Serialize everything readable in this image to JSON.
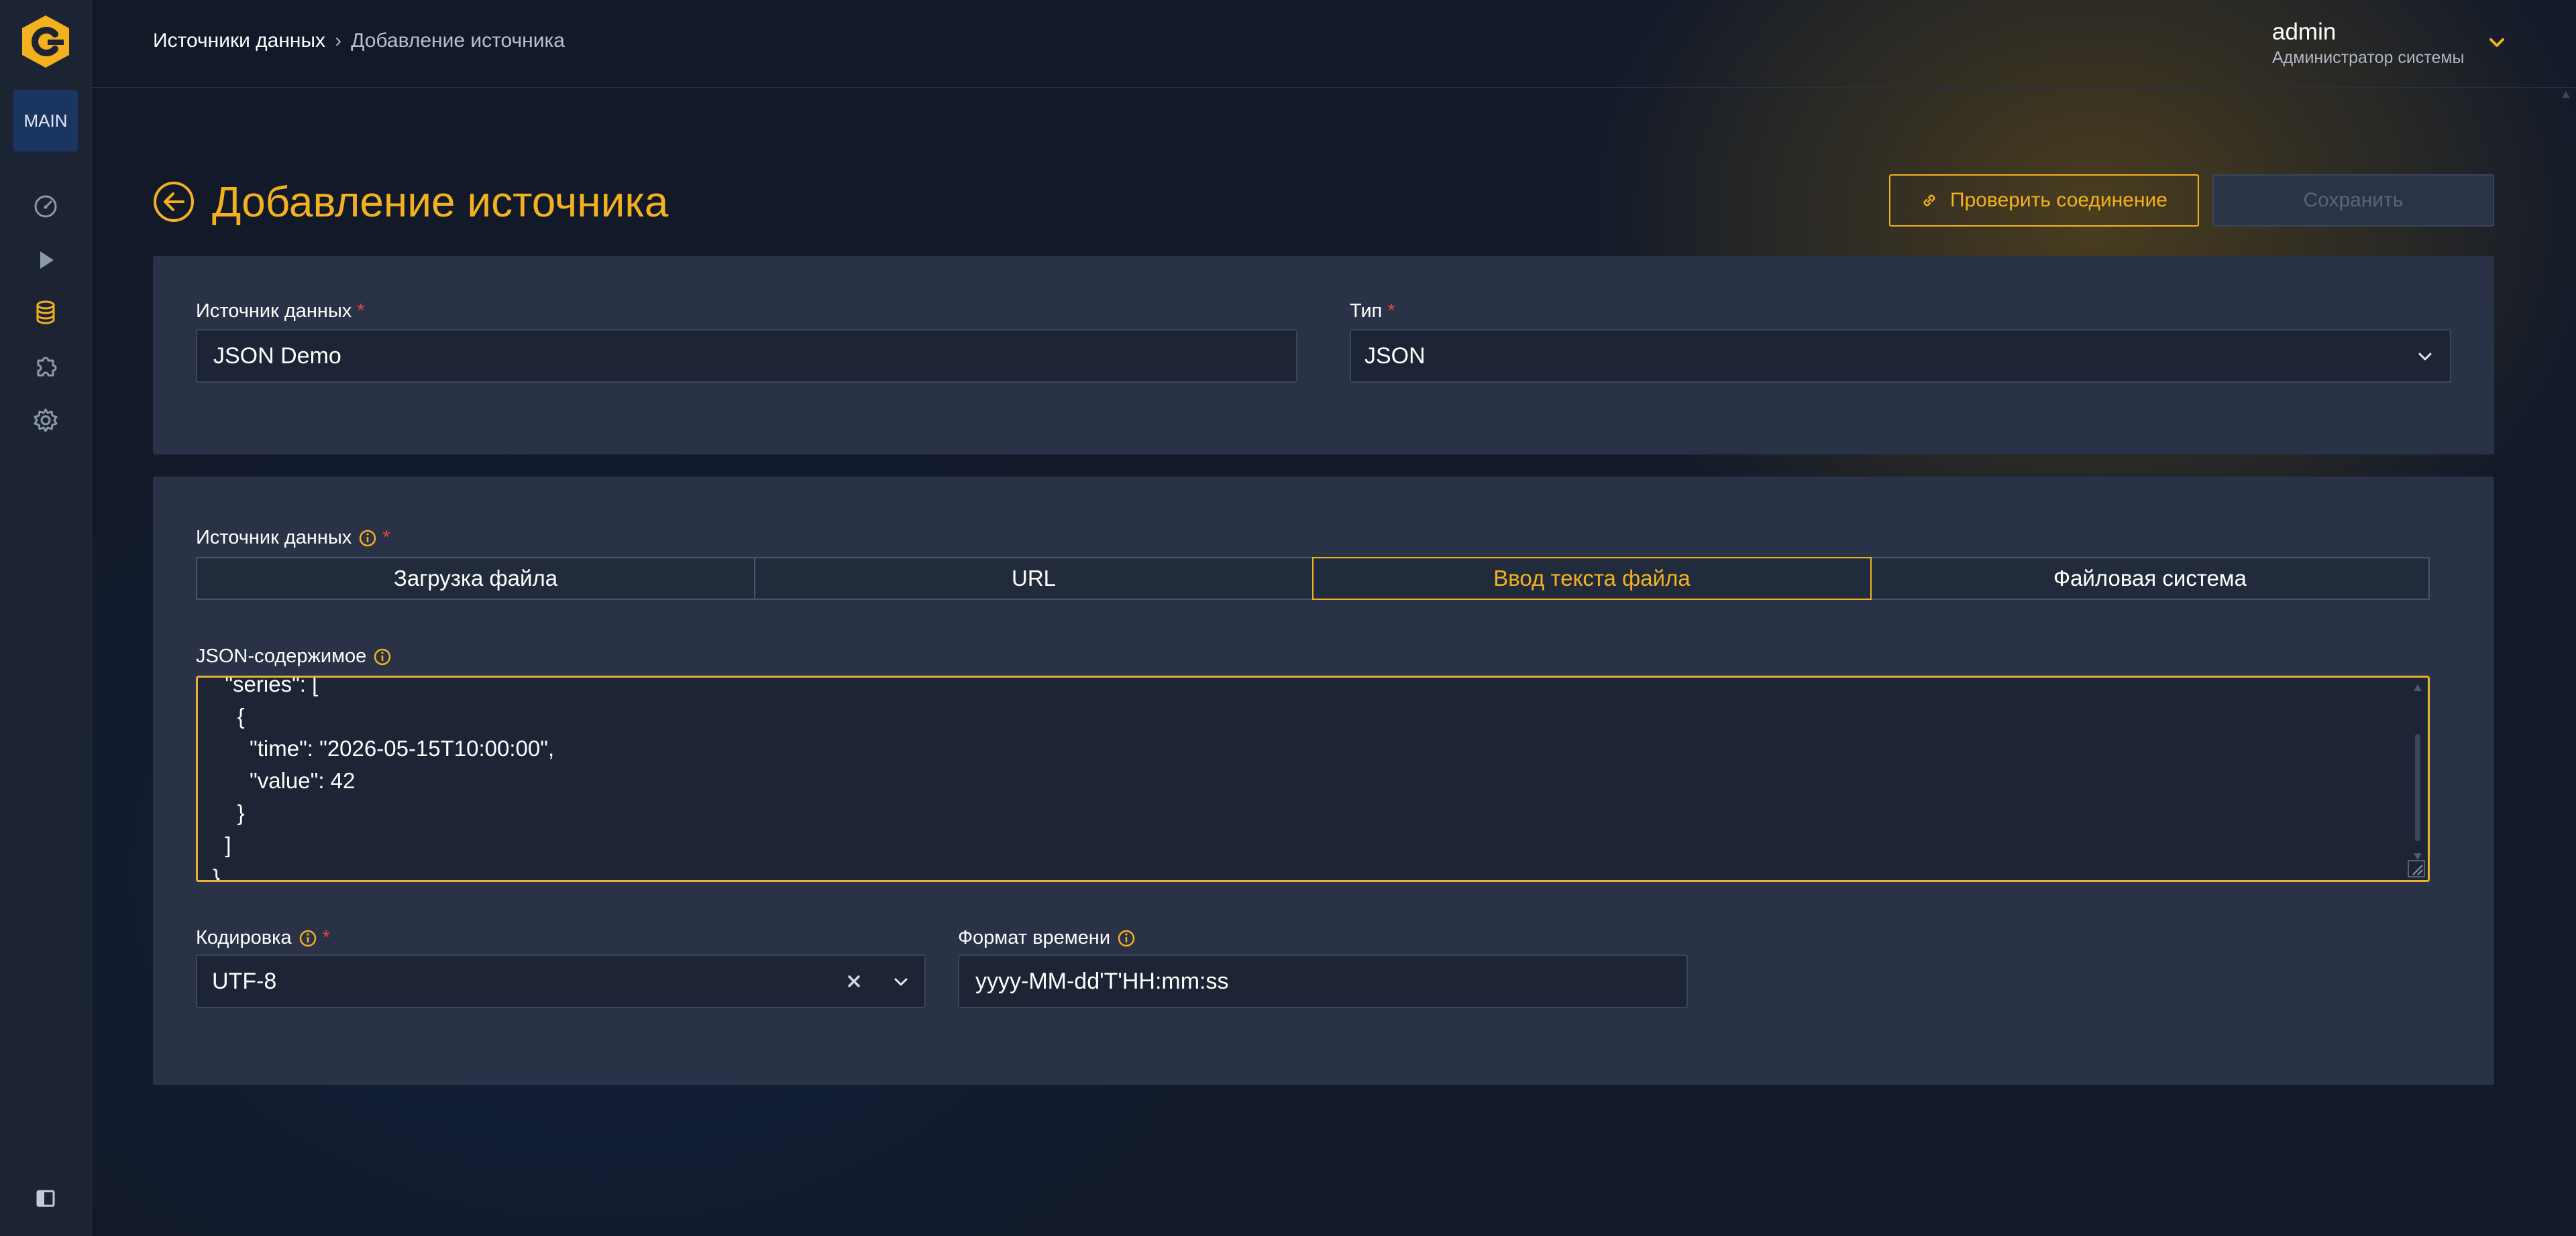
{
  "colors": {
    "accent": "#f3b120",
    "background": "#121a2a",
    "panel": "#293246",
    "required": "#e0483e"
  },
  "sidebar": {
    "workspace_badge": "MAIN",
    "items": [
      {
        "icon": "dashboard-icon"
      },
      {
        "icon": "play-icon"
      },
      {
        "icon": "database-icon",
        "active": true
      },
      {
        "icon": "puzzle-icon"
      },
      {
        "icon": "gear-icon"
      }
    ],
    "collapse_icon": "sidebar-toggle-icon"
  },
  "breadcrumb": {
    "root": "Источники данных",
    "current": "Добавление источника"
  },
  "user": {
    "name": "admin",
    "role": "Администратор системы"
  },
  "page": {
    "title": "Добавление источника"
  },
  "actions": {
    "check_label": "Проверить соединение",
    "save_label": "Сохранить"
  },
  "form": {
    "source_name": {
      "label": "Источник данных",
      "required_mark": "*",
      "value": "JSON Demo"
    },
    "type": {
      "label": "Тип",
      "required_mark": "*",
      "value": "JSON"
    },
    "data_source": {
      "label": "Источник данных",
      "required_mark": "*",
      "tabs": [
        "Загрузка файла",
        "URL",
        "Ввод текста файла",
        "Файловая система"
      ],
      "active_tab": "Ввод текста файла"
    },
    "json_content": {
      "label": "JSON-содержимое",
      "lines": [
        "  \"series\": [",
        "    {",
        "      \"time\": \"2026-05-15T10:00:00\",",
        "      \"value\": 42",
        "    }",
        "  ]",
        "}"
      ]
    },
    "encoding": {
      "label": "Кодировка",
      "required_mark": "*",
      "value": "UTF-8"
    },
    "time_format": {
      "label": "Формат времени",
      "value": "yyyy-MM-dd'T'HH:mm:ss"
    }
  }
}
